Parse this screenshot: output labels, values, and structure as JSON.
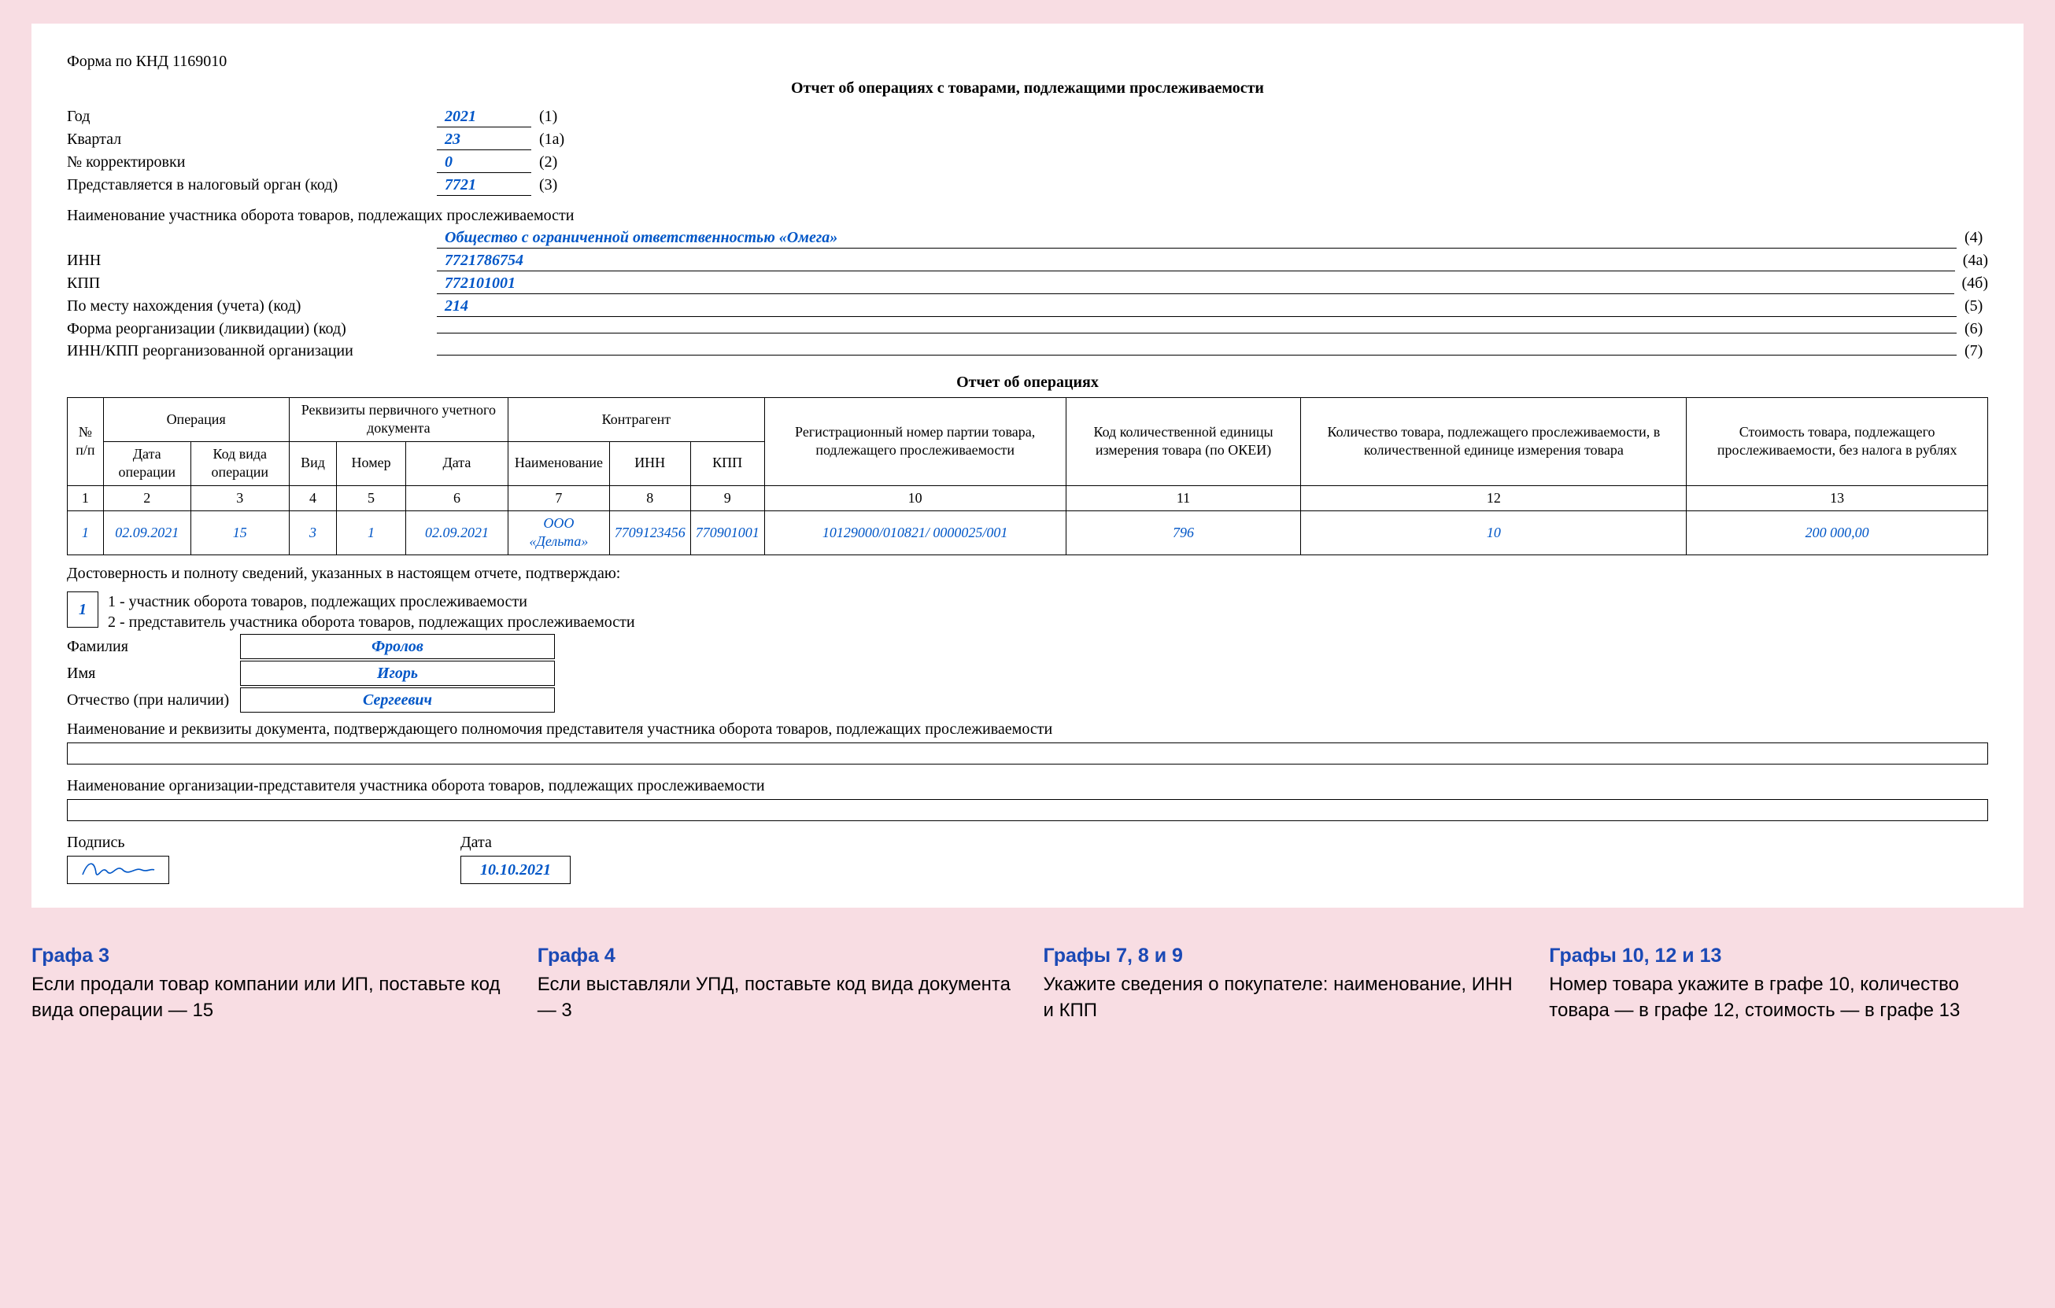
{
  "header": {
    "form_code": "Форма по КНД 1169010",
    "title": "Отчет об операциях с товарами, подлежащими прослеживаемости"
  },
  "fields": {
    "year": {
      "label": "Год",
      "value": "2021",
      "suffix": "(1)"
    },
    "quarter": {
      "label": "Квартал",
      "value": "23",
      "suffix": "(1а)"
    },
    "correction": {
      "label": "№ корректировки",
      "value": "0",
      "suffix": "(2)"
    },
    "tax_auth": {
      "label": "Представляется в налоговый орган (код)",
      "value": "7721",
      "suffix": "(3)"
    },
    "org_name_label": "Наименование участника оборота товаров, подлежащих прослеживаемости",
    "org_name": {
      "value": "Общество с ограниченной ответственностью «Омега»",
      "suffix": "(4)"
    },
    "inn": {
      "label": "ИНН",
      "value": "7721786754",
      "suffix": "(4а)"
    },
    "kpp": {
      "label": "КПП",
      "value": "772101001",
      "suffix": "(4б)"
    },
    "location": {
      "label": "По месту нахождения (учета) (код)",
      "value": "214",
      "suffix": "(5)"
    },
    "reorg_form": {
      "label": "Форма реорганизации (ликвидации) (код)",
      "value": "",
      "suffix": "(6)"
    },
    "reorg_inn_kpp": {
      "label": "ИНН/КПП реорганизованной организации",
      "value": "",
      "suffix": "(7)"
    }
  },
  "ops_table": {
    "subtitle": "Отчет об операциях",
    "head1": {
      "num": "№ п/п",
      "operation": "Операция",
      "doc": "Реквизиты первичного учетного документа",
      "counterparty": "Контрагент",
      "reg_num": "Регистрационный номер партии товара, подлежащего прослеживаемости",
      "unit_code": "Код коли­чественной единицы измерения товара (по ОКЕИ)",
      "qty": "Количество товара, подлежащего прослеживаемости, в количественной еди­нице измерения товара",
      "cost": "Стоимость товара, подлежащего прослеживаемости, без налога в рублях"
    },
    "head2": {
      "op_date": "Дата операции",
      "op_code": "Код вида операции",
      "doc_kind": "Вид",
      "doc_num": "Номер",
      "doc_date": "Дата",
      "cp_name": "Наименование",
      "cp_inn": "ИНН",
      "cp_kpp": "КПП"
    },
    "col_nums": [
      "1",
      "2",
      "3",
      "4",
      "5",
      "6",
      "7",
      "8",
      "9",
      "10",
      "11",
      "12",
      "13"
    ],
    "row": {
      "n": "1",
      "op_date": "02.09.2021",
      "op_code": "15",
      "doc_kind": "3",
      "doc_num": "1",
      "doc_date": "02.09.2021",
      "cp_name": "ООО «Дельта»",
      "cp_inn": "7709123456",
      "cp_kpp": "770901001",
      "reg_num": "10129000/010821/ 0000025/001",
      "unit_code": "796",
      "qty": "10",
      "cost": "200 000,00"
    }
  },
  "confirm": {
    "intro": "Достоверность и полноту сведений, указанных в настоящем отчете, подтверждаю:",
    "box": "1",
    "line1": "1 - участник оборота товаров, подлежащих прослеживаемости",
    "line2": "2 - представитель участника оборота товаров, подлежащих прослеживаемости",
    "surname": {
      "label": "Фамилия",
      "value": "Фролов"
    },
    "name": {
      "label": "Имя",
      "value": "Игорь"
    },
    "patronymic": {
      "label": "Отчество (при наличии)",
      "value": "Сергеевич"
    },
    "doc_auth_label": "Наименование и реквизиты документа, подтверждающего полномочия представителя участника оборота товаров, подлежащих прослеживаемости",
    "org_rep_label": "Наименование организации-представителя участника оборота товаров, подлежащих прослеживаемости",
    "signature_label": "Подпись",
    "date_label": "Дата",
    "date_value": "10.10.2021"
  },
  "callouts": [
    {
      "title": "Графа 3",
      "text": "Если продали товар компании или ИП, поставьте код вида операции — 15"
    },
    {
      "title": "Графа 4",
      "text": "Если выставляли УПД, поставьте код вида документа — 3"
    },
    {
      "title": "Графы 7, 8 и 9",
      "text": "Укажите сведения о по­купателе: наименование, ИНН и КПП"
    },
    {
      "title": "Графы 10, 12 и 13",
      "text": "Номер товара укажите в графе 10, количество товара — в графе 12, стоимость — в графе 13"
    }
  ]
}
